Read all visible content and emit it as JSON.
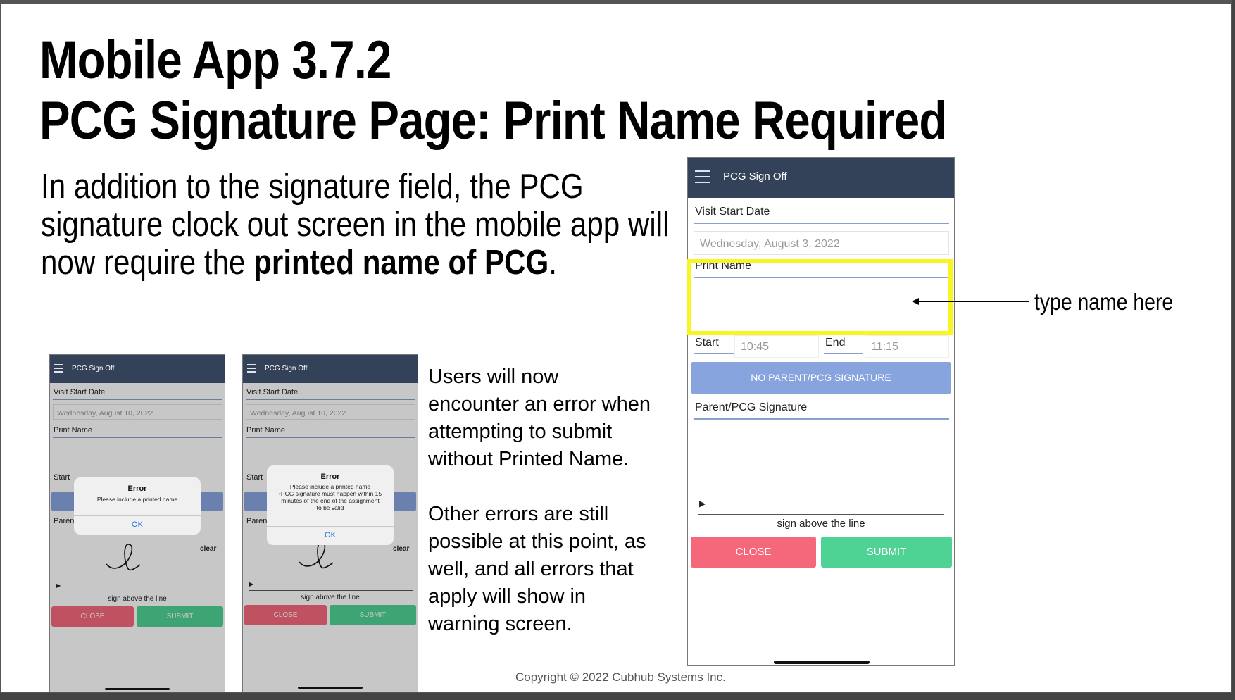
{
  "slide": {
    "title_line1": "Mobile App 3.7.2",
    "title_line2": "PCG Signature Page: Print Name Required",
    "intro_line1": "In addition to the signature field, the PCG",
    "intro_line2": "signature clock out screen in the mobile app will",
    "intro_line3_pre": "now require the ",
    "intro_line3_bold": "printed name of PCG",
    "intro_line3_post": ".",
    "note_lines": [
      "Users will now",
      "encounter an error when",
      "attempting to submit",
      "without Printed Name.",
      "",
      "Other errors are still",
      "possible at this point, as",
      "well, and all errors that",
      "apply will show in",
      "warning screen."
    ],
    "annotation": "type name here",
    "copyright": "Copyright © 2022 Cubhub Systems Inc."
  },
  "big_phone": {
    "bar_title": "PCG Sign Off",
    "visit_start_label": "Visit Start Date",
    "visit_start_value": "Wednesday, August 3, 2022",
    "print_name_label": "Print Name",
    "print_name_value": "",
    "start_label": "Start",
    "start_value": "10:45",
    "end_label": "End",
    "end_value": "11:15",
    "no_signature_button": "NO PARENT/PCG SIGNATURE",
    "signature_label": "Parent/PCG Signature",
    "sign_marker": "▶",
    "sign_hint": "sign above the line",
    "close_button": "CLOSE",
    "submit_button": "SUBMIT"
  },
  "small_phones": [
    {
      "bar_title": "PCG Sign Off",
      "visit_start_label": "Visit Start Date",
      "visit_start_value": "Wednesday, August 10, 2022",
      "print_name_label": "Print Name",
      "start_label": "Start",
      "parent_label_partial": "Paren",
      "clear_label": "clear",
      "sign_marker": "▶",
      "sign_hint": "sign above the line",
      "close_button": "CLOSE",
      "submit_button": "SUBMIT",
      "dialog_title": "Error",
      "dialog_messages": [
        "Please include a printed name"
      ],
      "dialog_ok": "OK"
    },
    {
      "bar_title": "PCG Sign Off",
      "visit_start_label": "Visit Start Date",
      "visit_start_value": "Wednesday, August 10, 2022",
      "print_name_label": "Print Name",
      "start_label": "Start",
      "parent_label_partial": "Paren",
      "clear_label": "clear",
      "sign_marker": "▶",
      "sign_hint": "sign above the line",
      "close_button": "CLOSE",
      "submit_button": "SUBMIT",
      "dialog_title": "Error",
      "dialog_messages": [
        "Please include a printed name",
        "•PCG signature must happen within 15",
        "minutes of the end of the assignment",
        "to be valid"
      ],
      "dialog_ok": "OK"
    }
  ],
  "colors": {
    "topbar": "#334258",
    "no_signature_button": "#88a4df",
    "close_button": "#f5687c",
    "submit_button": "#4fd394",
    "highlight": "#f8f520"
  }
}
